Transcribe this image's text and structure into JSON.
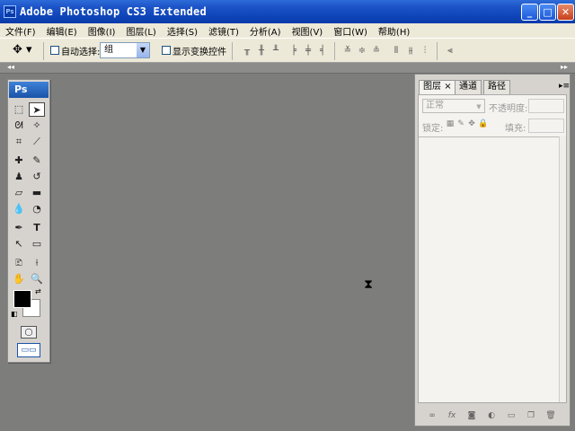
{
  "window": {
    "title": "Adobe Photoshop CS3 Extended",
    "app_logo": "Ps",
    "buttons": {
      "minimize": "_",
      "maximize": "□",
      "close": "✕"
    }
  },
  "menus": [
    "文件(F)",
    "编辑(E)",
    "图像(I)",
    "图层(L)",
    "选择(S)",
    "滤镜(T)",
    "分析(A)",
    "视图(V)",
    "窗口(W)",
    "帮助(H)"
  ],
  "options": {
    "tool_preset_icon": "move-tool-icon",
    "auto_select_label": "自动选择:",
    "auto_select_value": "组",
    "show_transform_label": "显示变换控件",
    "align_icons": [
      "align-top",
      "align-vcenter",
      "align-bottom",
      "align-left",
      "align-hcenter",
      "align-right"
    ],
    "distribute_icons": [
      "dist-top",
      "dist-vcenter",
      "dist-bottom",
      "dist-left",
      "dist-hcenter",
      "dist-right"
    ]
  },
  "toolbox": {
    "badge": "Ps",
    "tools": [
      {
        "name": "marquee-tool-icon",
        "glyph": "⬚"
      },
      {
        "name": "move-tool-icon",
        "glyph": "➤",
        "active": true
      },
      {
        "name": "lasso-tool-icon",
        "glyph": "ᘛ"
      },
      {
        "name": "magic-wand-tool-icon",
        "glyph": "✧"
      },
      {
        "name": "crop-tool-icon",
        "glyph": "⌗"
      },
      {
        "name": "slice-tool-icon",
        "glyph": "⟋"
      },
      {
        "name": "healing-brush-tool-icon",
        "glyph": "✚"
      },
      {
        "name": "brush-tool-icon",
        "glyph": "✎"
      },
      {
        "name": "clone-stamp-tool-icon",
        "glyph": "♟"
      },
      {
        "name": "history-brush-tool-icon",
        "glyph": "↺"
      },
      {
        "name": "eraser-tool-icon",
        "glyph": "▱"
      },
      {
        "name": "gradient-tool-icon",
        "glyph": "▬"
      },
      {
        "name": "blur-tool-icon",
        "glyph": "💧"
      },
      {
        "name": "dodge-tool-icon",
        "glyph": "◔"
      },
      {
        "name": "pen-tool-icon",
        "glyph": "✒"
      },
      {
        "name": "type-tool-icon",
        "glyph": "T"
      },
      {
        "name": "path-selection-tool-icon",
        "glyph": "↖"
      },
      {
        "name": "shape-tool-icon",
        "glyph": "▭"
      },
      {
        "name": "notes-tool-icon",
        "glyph": "🗈"
      },
      {
        "name": "eyedropper-tool-icon",
        "glyph": "⟊"
      },
      {
        "name": "hand-tool-icon",
        "glyph": "✋"
      },
      {
        "name": "zoom-tool-icon",
        "glyph": "🔍"
      }
    ],
    "foreground_color": "#000000",
    "background_color": "#ffffff"
  },
  "layers_panel": {
    "tabs": [
      {
        "label": "图层",
        "active": true,
        "closable": "×"
      },
      {
        "label": "通道",
        "active": false
      },
      {
        "label": "路径",
        "active": false
      }
    ],
    "blend_mode": "正常",
    "opacity_label": "不透明度:",
    "lock_label": "锁定:",
    "fill_label": "填充:",
    "footer_icons": [
      "link-layers-icon",
      "fx-icon",
      "layer-mask-icon",
      "adjustment-layer-icon",
      "new-group-icon",
      "new-layer-icon",
      "delete-layer-icon"
    ]
  },
  "workspace_color": "#7d7d7b"
}
